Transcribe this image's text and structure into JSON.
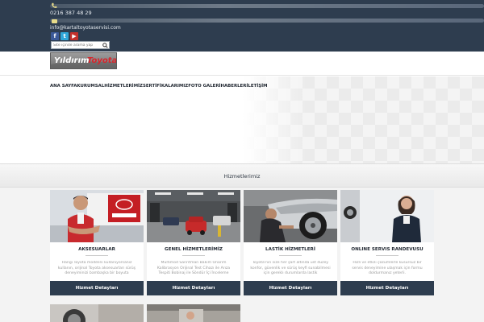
{
  "header": {
    "phone": "0216 387 48 29",
    "email": "info@kartaltoyotaservisi.com",
    "social": [
      "facebook-icon",
      "twitter-icon",
      "youtube-icon"
    ],
    "search_placeholder": "Site içinde arama yap"
  },
  "logo": {
    "part1": "Yıldırım",
    "part2": "Toyota"
  },
  "nav": {
    "items": [
      "ANA SAYFA",
      "KURUMSAL",
      "HİZMETLERİMİZ",
      "SERTİFİKALARIMIZ",
      "FOTO GALERİ",
      "HABERLER",
      "İLETİŞİM"
    ]
  },
  "section": {
    "title": "Hizmetlerimiz"
  },
  "cards": [
    {
      "title": "AKSESUARLAR",
      "text": "Hangi Toyota modelini kullanıyorsanız kullanın, orijinal Toyota aksesuarları sürüş deneyiminizi bambaşka bir boyuta",
      "button": "Hizmet Detayları"
    },
    {
      "title": "GENEL HİZMETLERİMİZ",
      "text": "Multimod Sanrıtman Bakım Onarım Kalibrasyon Orijinal Test Cihazı ile Arıza Tespiti Bobinaj ile Söndür İçi İnceleme",
      "button": "Hizmet Detayları"
    },
    {
      "title": "LASTİK HİZMETLERİ",
      "text": "Toyota'nın size her şart altında üst düzey konfor, güvenlik ve sürüş keyfi sunabilmesi için gereklı durumlarda lastik",
      "button": "Hizmet Detayları"
    },
    {
      "title": "ONLINE SERVIS RANDEVUSU",
      "text": "Hızlı ve etkili çözümlerle kusursuz bir servis deneyimine ulaşmak için formu doldurmanız yeterli.",
      "button": "Hizmet Detayları"
    }
  ],
  "colors": {
    "header_bg": "#2e3d4f",
    "button_bg": "#2e3d4f",
    "logo_red": "#d8242a"
  }
}
